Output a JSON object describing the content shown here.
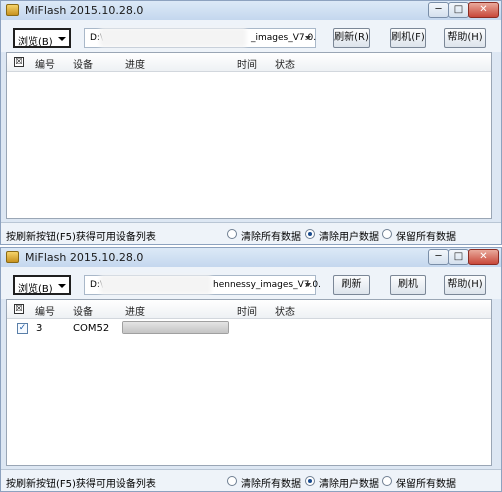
{
  "windows": [
    {
      "title": "MiFlash 2015.10.28.0",
      "controls": {
        "minimize": "─",
        "maximize": "□",
        "close": "✕"
      },
      "select_value": "浏览(B)",
      "path_prefix": "D:\\",
      "path_suffix": "_images_V7.0.",
      "buttons": {
        "refresh": "刷新(R)",
        "flash": "刷机(F)",
        "help": "帮助(H)"
      },
      "columns": {
        "check": "☒",
        "id": "编号",
        "device": "设备",
        "progress": "进度",
        "time": "时间",
        "status": "状态"
      },
      "rows": [],
      "status_text": "按刷新按钮(F5)获得可用设备列表",
      "options": [
        "清除所有数据",
        "清除用户数据",
        "保留所有数据"
      ],
      "selected_option": "清除用户数据"
    },
    {
      "title": "MiFlash 2015.10.28.0",
      "controls": {
        "minimize": "─",
        "maximize": "□",
        "close": "✕"
      },
      "select_value": "浏览(B)",
      "path_prefix": "D:\\",
      "path_suffix": "hennessy_images_V7.0.",
      "buttons": {
        "refresh": "刷新",
        "flash": "刷机",
        "help": "帮助(H)"
      },
      "columns": {
        "check": "☒",
        "id": "编号",
        "device": "设备",
        "progress": "进度",
        "time": "时间",
        "status": "状态"
      },
      "rows": [
        {
          "checked": "✓",
          "id": "3",
          "device": "COM52",
          "progress": 1.0,
          "time": "",
          "status": ""
        }
      ],
      "status_text": "按刷新按钮(F5)获得可用设备列表",
      "options": [
        "清除所有数据",
        "清除用户数据",
        "保留所有数据"
      ],
      "selected_option": "清除用户数据"
    }
  ]
}
